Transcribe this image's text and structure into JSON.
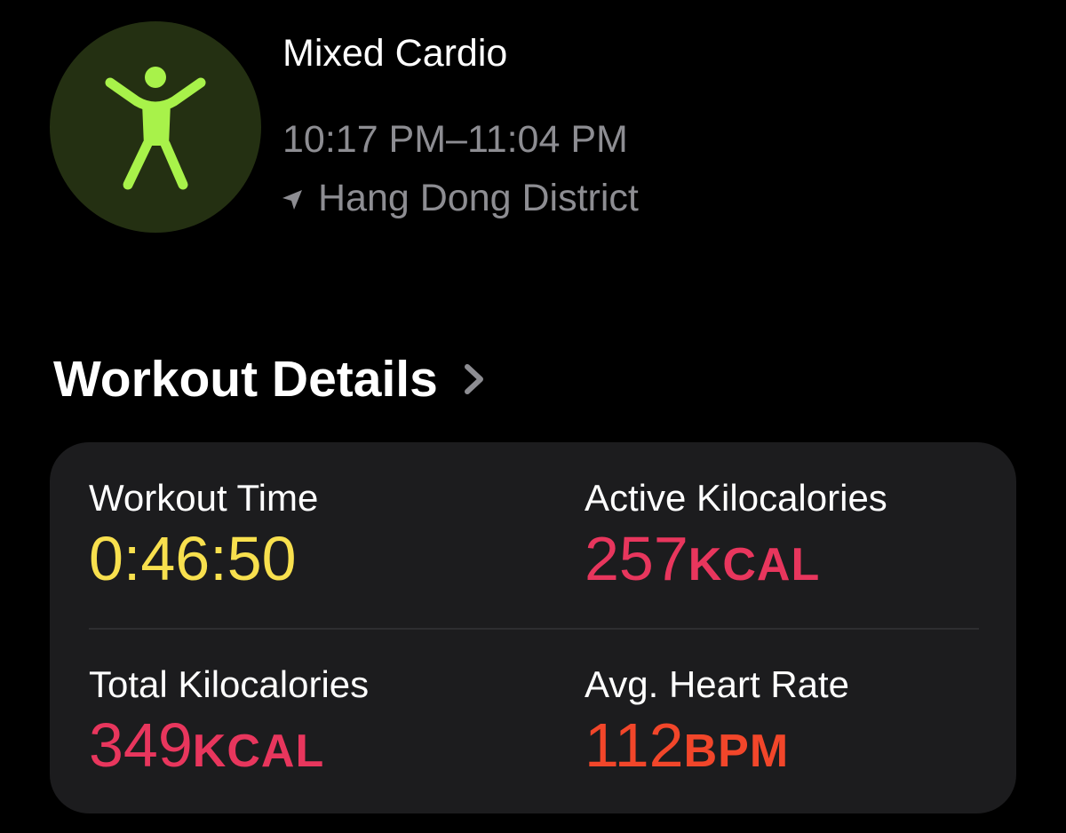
{
  "workout": {
    "icon": "figure-jumping-jacks-icon",
    "title": "Mixed Cardio",
    "time_range": "10:17 PM–11:04 PM",
    "location_icon": "location-arrow-icon",
    "location": "Hang Dong District"
  },
  "details": {
    "header": "Workout Details",
    "chevron_icon": "chevron-right-icon",
    "metrics": [
      {
        "label": "Workout Time",
        "value": "0:46:50",
        "unit": "",
        "color": "#f8e04e"
      },
      {
        "label": "Active Kilocalories",
        "value": "257",
        "unit": "KCAL",
        "color": "#e8365d"
      },
      {
        "label": "Total Kilocalories",
        "value": "349",
        "unit": "KCAL",
        "color": "#e8365d"
      },
      {
        "label": "Avg. Heart Rate",
        "value": "112",
        "unit": "BPM",
        "color": "#f2462a"
      }
    ]
  },
  "colors": {
    "background": "#000000",
    "card": "#1c1c1e",
    "activity_green": "#a8f24a",
    "badge_background": "#243012",
    "secondary_text": "#8d8d92"
  }
}
